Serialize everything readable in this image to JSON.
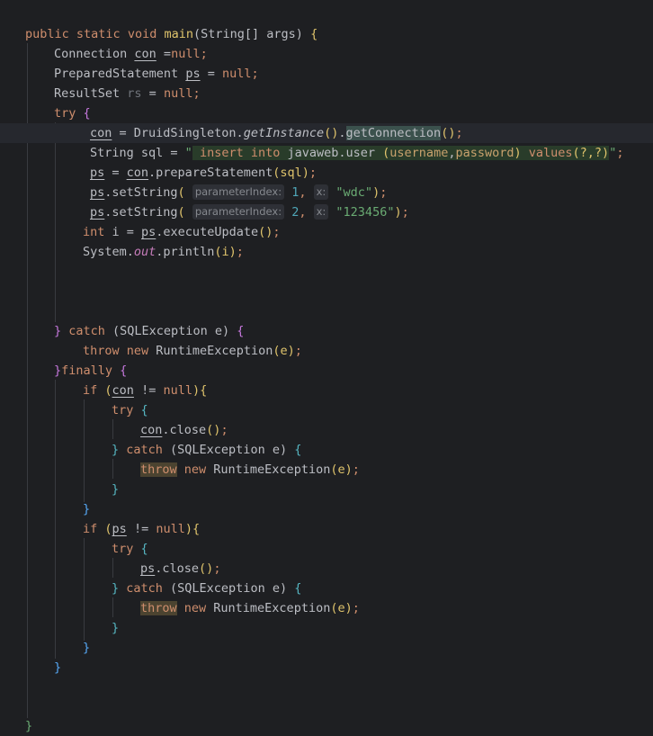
{
  "code": {
    "method_signature": {
      "kw_public": "public",
      "kw_static": "static",
      "kw_void": "void",
      "method_name": "main",
      "params": "(String[] args) ",
      "open_brace": "{"
    },
    "decl_connection": {
      "type": "Connection ",
      "var": "con",
      "eq": " =",
      "value": "null",
      "semi": ";"
    },
    "decl_ps": {
      "type": "PreparedStatement ",
      "var": "ps",
      "eq": " = ",
      "value": "null",
      "semi": ";"
    },
    "decl_rs": {
      "type": "ResultSet ",
      "var": "rs",
      "eq": " = ",
      "value": "null",
      "semi": ";"
    },
    "try_open": {
      "kw": "try",
      "brace": " {"
    },
    "get_connection": {
      "var": "con",
      "eq": " = DruidSingleton.",
      "method": "getInstance",
      "parens": "()",
      "dot": ".",
      "method2": "getConnection",
      "parens2": "()",
      "semi": ";"
    },
    "sql_line": {
      "prefix": "String sql = ",
      "quote_open": "\"",
      "sql_insert": " insert into ",
      "sql_table": "javaweb.user ",
      "sql_paren_open": "(",
      "sql_col1": "username",
      "sql_comma": ",",
      "sql_col2": "password",
      "sql_paren_close": ")",
      "sql_values": " values",
      "sql_vals_args": "(?,?)",
      "quote_close": "\"",
      "semi": ";"
    },
    "prepare": {
      "var": "ps",
      "eq": " = ",
      "var2": "con",
      "rest": ".prepareStatement",
      "args": "(sql)",
      "semi": ";"
    },
    "set_string_1": {
      "var": "ps",
      "call": ".setString",
      "paren": "(",
      "hint1": "parameterIndex:",
      "arg1": " 1",
      "comma": ", ",
      "hint2": "x:",
      "arg2": " \"wdc\"",
      "close": ")",
      "semi": ";"
    },
    "set_string_2": {
      "var": "ps",
      "call": ".setString",
      "paren": "(",
      "hint1": "parameterIndex:",
      "arg1": " 2",
      "comma": ", ",
      "hint2": "x:",
      "arg2": " \"123456\"",
      "close": ")",
      "semi": ";"
    },
    "execute": {
      "kw": "int",
      "rest": " i = ",
      "var": "ps",
      "call": ".executeUpdate",
      "parens": "()",
      "semi": ";"
    },
    "println": {
      "cls": "System.",
      "field": "out",
      "call": ".println",
      "args": "(i)",
      "semi": ";"
    },
    "catch_outer": {
      "brace": "} ",
      "kw": "catch",
      "args": " (SQLException e) ",
      "open": "{"
    },
    "throw_outer": {
      "kw_throw": "throw",
      "kw_new": " new",
      "rest": " RuntimeException",
      "args": "(e)",
      "semi": ";"
    },
    "finally": {
      "brace": "}",
      "kw": "finally",
      "open": " {"
    },
    "if_con": {
      "kw": "if",
      "space": " ",
      "open": "(",
      "var": "con",
      "rest": " != ",
      "value": "null",
      "close": ")",
      "brace": "{"
    },
    "try_inner": {
      "kw": "try",
      "brace": " {"
    },
    "con_close": {
      "var": "con",
      "rest": ".close",
      "parens": "()",
      "semi": ";"
    },
    "catch_inner": {
      "brace": "} ",
      "kw": "catch",
      "args": " (SQLException e) ",
      "open": "{"
    },
    "throw_inner": {
      "kw_throw": "throw",
      "kw_new": " new",
      "rest": " RuntimeException",
      "args": "(e)",
      "semi": ";"
    },
    "close_brace": "}",
    "if_ps": {
      "kw": "if",
      "space": " ",
      "open": "(",
      "var": "ps",
      "rest": " != ",
      "value": "null",
      "close": ")",
      "brace": "{"
    },
    "ps_close": {
      "var": "ps",
      "rest": ".close",
      "parens": "()",
      "semi": ";"
    }
  },
  "colors": {
    "background": "#1e1f22",
    "keyword": "#cf8e6d",
    "function": "#56a8f5",
    "string": "#6aab73",
    "default_text": "#bcbec4"
  }
}
